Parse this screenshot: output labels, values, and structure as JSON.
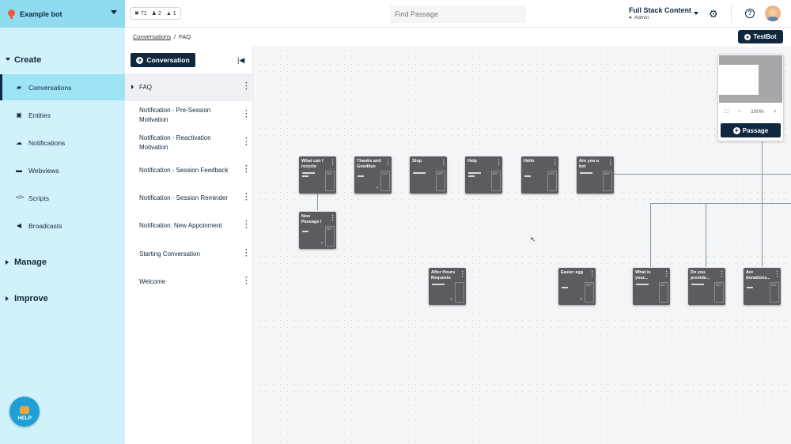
{
  "bot": {
    "name": "Example bot"
  },
  "stats": {
    "a": "71",
    "b": "2",
    "c": "1"
  },
  "search": {
    "placeholder": "Find Passage"
  },
  "account": {
    "org": "Full Stack Content",
    "role": "Admin"
  },
  "sidebar": {
    "create_label": "Create",
    "manage_label": "Manage",
    "improve_label": "Improve",
    "items": [
      {
        "label": "Conversations",
        "icon": "chat-icon"
      },
      {
        "label": "Entities",
        "icon": "entity-icon"
      },
      {
        "label": "Notifications",
        "icon": "bell-icon"
      },
      {
        "label": "Webviews",
        "icon": "window-icon"
      },
      {
        "label": "Scripts",
        "icon": "code-icon"
      },
      {
        "label": "Broadcasts",
        "icon": "megaphone-icon"
      }
    ],
    "help_label": "HELP"
  },
  "breadcrumb": {
    "parent": "Conversations",
    "separator": "/",
    "current": "FAQ"
  },
  "toolbar": {
    "testbot_label": "TestBot",
    "new_conversation_label": "Conversation"
  },
  "conversations": [
    "FAQ",
    "Notification - Pre-Session Motivation",
    "Notification - Reactivation Motivation",
    "Notification - Session Feedback",
    "Notification - Session Reminder",
    "Notification: New Appoinment",
    "Starting Conversation",
    "Welcome"
  ],
  "nodes": [
    {
      "title": "What can I recycle",
      "tag": "SEF"
    },
    {
      "title": "Thanks and Goodbye",
      "tag": "SYE"
    },
    {
      "title": "Stop",
      "tag": "SEF"
    },
    {
      "title": "Help",
      "tag": "SEF"
    },
    {
      "title": "Hello",
      "tag": "SYE"
    },
    {
      "title": "Are you a bot",
      "tag": "SEF"
    },
    {
      "title": "New Passage I",
      "tag": "SEF"
    },
    {
      "title": "After Hours Requests",
      "tag": ""
    },
    {
      "title": "Easter egg",
      "tag": "SEF"
    },
    {
      "title": "What is your...",
      "tag": "SEF"
    },
    {
      "title": "Do you provide...",
      "tag": "SEF"
    },
    {
      "title": "Are donations...",
      "tag": "SEF"
    }
  ],
  "minimap": {
    "zoom": "100%",
    "add_passage_label": "Passage",
    "minus": "−",
    "plus": "+"
  },
  "colors": {
    "sidebar_bg": "#d2f2fb",
    "bot_header": "#8fdcf0",
    "primary": "#10283e",
    "node_bg": "#5a5c5f",
    "help_bg": "#1e9fd8"
  }
}
